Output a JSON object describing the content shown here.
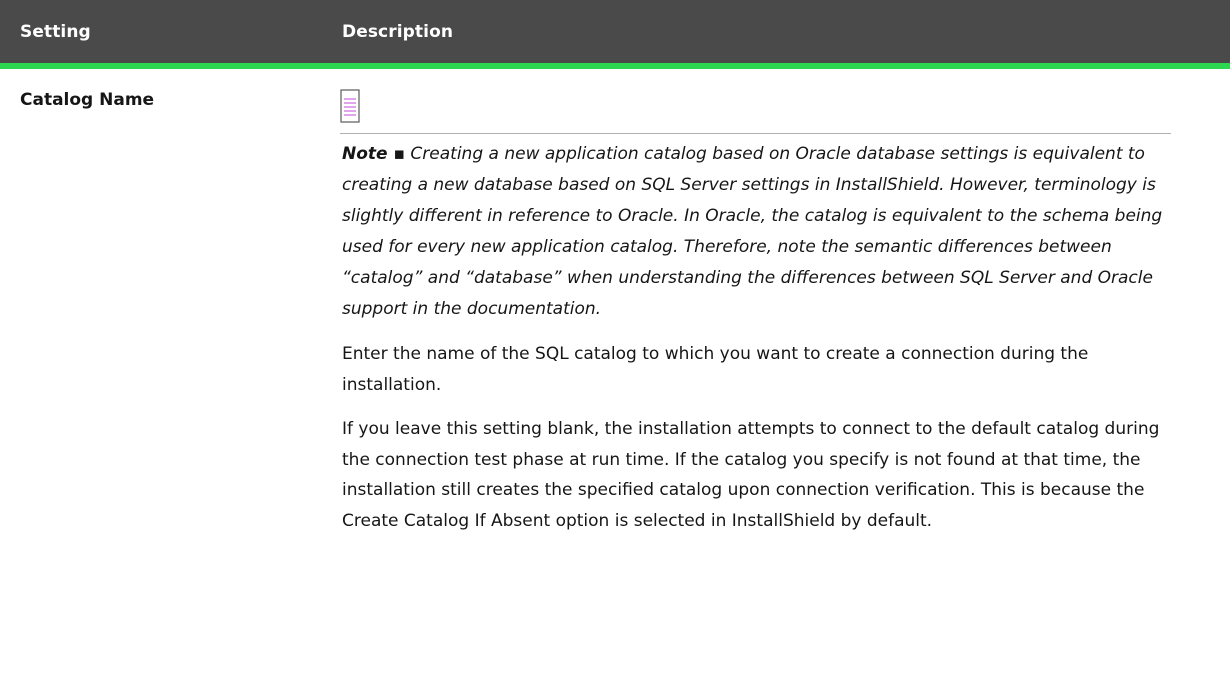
{
  "table": {
    "headers": {
      "setting": "Setting",
      "description": "Description"
    },
    "rows": [
      {
        "setting": "Catalog Name",
        "note_label": "Note ▪",
        "note_text": " Creating a new application catalog based on Oracle database settings is equivalent to creating a new database based on SQL Server settings in InstallShield. However, terminology is slightly different in reference to Oracle. In Oracle, the catalog is equivalent to the schema being used for every new application catalog. Therefore, note the semantic differences between “catalog” and “database” when understanding the differences between SQL Server and Oracle support in the documentation.",
        "paragraph_1": "Enter the name of the SQL catalog to which you want to create a connection during the installation.",
        "paragraph_2": "If you leave this setting blank, the installation attempts to connect to the default catalog during the connection test phase at run time. If the catalog you specify is not found at that time, the installation still creates the specified catalog upon connection verification. This is because the Create Catalog If Absent option is selected in InstallShield by default."
      }
    ]
  },
  "colors": {
    "header_bg": "#4a4a4a",
    "header_accent": "#2bd84f",
    "icon_accent": "#c24bd6"
  },
  "icons": {
    "note": "note-icon"
  }
}
